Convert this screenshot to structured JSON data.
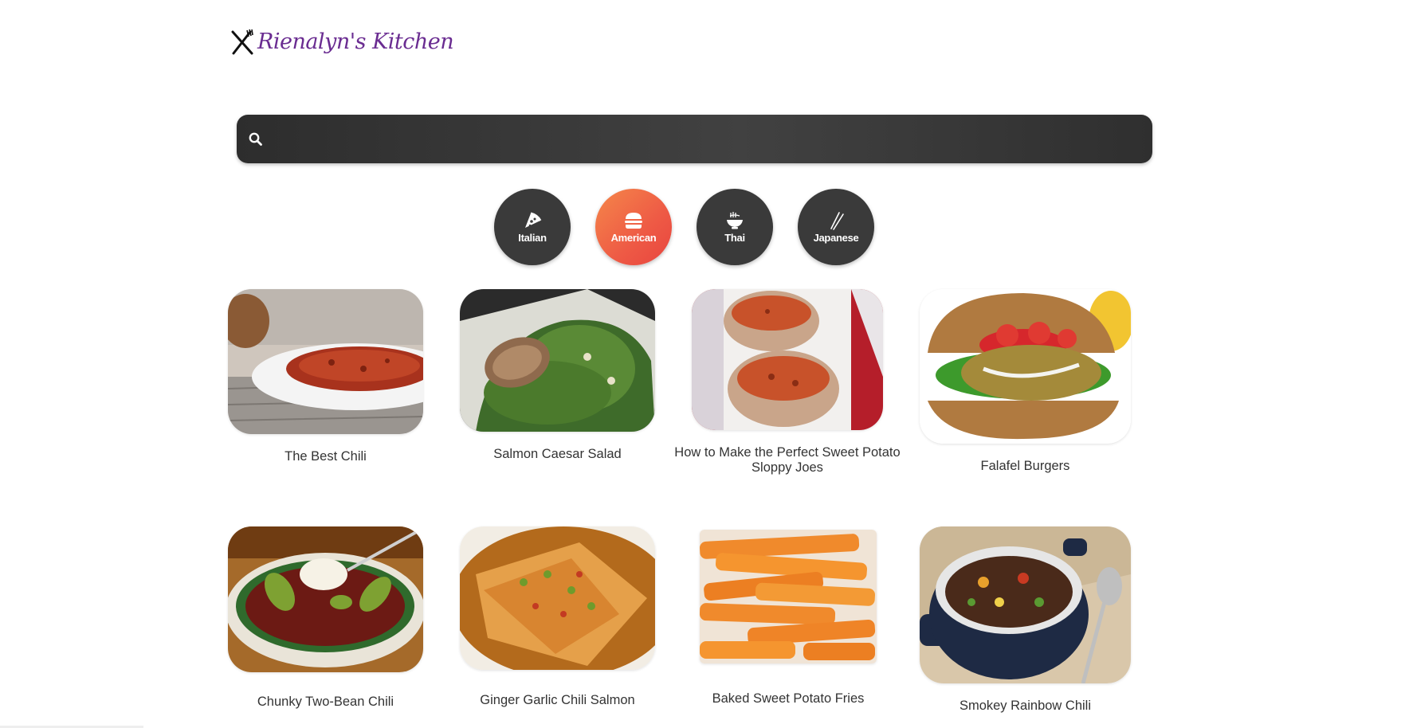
{
  "brand": {
    "name": "Rienalyn's Kitchen",
    "icon": "fork-knife-icon",
    "color": "#6a2c91"
  },
  "search": {
    "icon": "search-icon",
    "value": "",
    "placeholder": ""
  },
  "categories": [
    {
      "label": "Italian",
      "icon": "pizza-icon",
      "active": false
    },
    {
      "label": "American",
      "icon": "burger-icon",
      "active": true
    },
    {
      "label": "Thai",
      "icon": "noodle-bowl-icon",
      "active": false
    },
    {
      "label": "Japanese",
      "icon": "chopsticks-icon",
      "active": false
    }
  ],
  "recipes": [
    {
      "title": "The Best Chili"
    },
    {
      "title": "Salmon Caesar Salad"
    },
    {
      "title": "How to Make the Perfect Sweet Potato Sloppy Joes"
    },
    {
      "title": "Falafel Burgers"
    },
    {
      "title": "Chunky Two-Bean Chili"
    },
    {
      "title": "Ginger Garlic Chili Salmon"
    },
    {
      "title": "Baked Sweet Potato Fries"
    },
    {
      "title": "Smokey Rainbow Chili"
    }
  ],
  "colors": {
    "search_bar": "#3a3a3a",
    "category_inactive": "#3a3a3a",
    "category_active_from": "#f5874a",
    "category_active_to": "#e8453f"
  }
}
